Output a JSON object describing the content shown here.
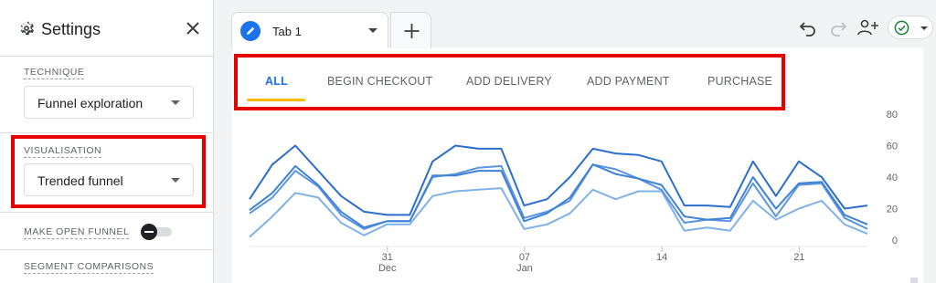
{
  "settings": {
    "title": "Settings",
    "technique_label": "TECHNIQUE",
    "technique_value": "Funnel exploration",
    "visualisation_label": "VISUALISATION",
    "visualisation_value": "Trended funnel",
    "open_funnel_label": "MAKE OPEN FUNNEL",
    "open_funnel_on": false,
    "segment_label": "SEGMENT COMPARISONS"
  },
  "tabs": {
    "active_label": "Tab 1",
    "add_label": "+"
  },
  "toolbar": {
    "undo_icon": "undo-icon",
    "redo_icon": "redo-icon",
    "share_icon": "person-add-icon",
    "status_icon": "check-circle-icon"
  },
  "step_tabs": [
    "ALL",
    "BEGIN CHECKOUT",
    "ADD DELIVERY",
    "ADD PAYMENT",
    "PURCHASE"
  ],
  "colors": {
    "accent": "#1a73e8",
    "highlight": "#e60000",
    "underline": "#fbbc04",
    "check": "#188038"
  },
  "chart_data": {
    "type": "line",
    "x_tick_labels": [
      {
        "day": "31",
        "month": "Dec"
      },
      {
        "day": "07",
        "month": "Jan"
      },
      {
        "day": "14",
        "month": ""
      },
      {
        "day": "21",
        "month": ""
      }
    ],
    "ylim": [
      0,
      80
    ],
    "y_ticks": [
      0,
      20,
      40,
      60,
      80
    ],
    "grid": false,
    "series": [
      {
        "color": "#2c6ecb",
        "values": [
          26,
          48,
          60,
          44,
          28,
          18,
          16,
          16,
          50,
          60,
          58,
          58,
          22,
          26,
          40,
          58,
          55,
          54,
          50,
          22,
          22,
          21,
          50,
          28,
          50,
          40,
          20,
          22
        ]
      },
      {
        "color": "#3f82d8",
        "values": [
          19,
          30,
          47,
          35,
          18,
          8,
          12,
          12,
          41,
          41,
          44,
          44,
          12,
          17,
          27,
          48,
          42,
          39,
          35,
          15,
          13,
          14,
          40,
          20,
          36,
          37,
          16,
          10
        ]
      },
      {
        "color": "#5b95e0",
        "values": [
          17,
          27,
          44,
          34,
          16,
          7,
          12,
          12,
          40,
          42,
          46,
          47,
          14,
          18,
          25,
          48,
          45,
          39,
          32,
          11,
          13,
          12,
          36,
          15,
          35,
          36,
          14,
          7
        ]
      },
      {
        "color": "#7fb2ea",
        "values": [
          2,
          15,
          30,
          27,
          11,
          3,
          10,
          10,
          28,
          31,
          32,
          33,
          7,
          10,
          17,
          32,
          26,
          31,
          31,
          6,
          8,
          6,
          25,
          13,
          20,
          25,
          10,
          4
        ]
      }
    ]
  }
}
